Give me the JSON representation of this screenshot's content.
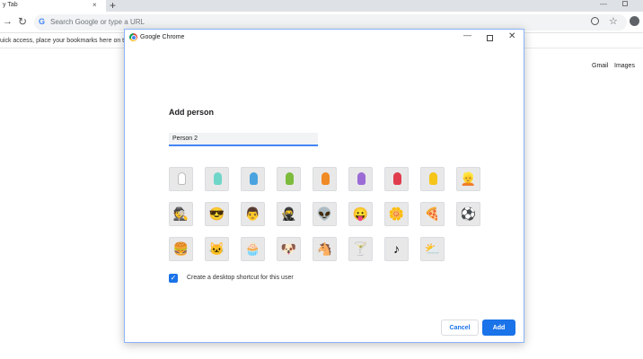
{
  "browser": {
    "tab_title": "y Tab",
    "tab_close": "×",
    "new_tab": "+",
    "window_min": "—",
    "omnibox_placeholder": "Search Google or type a URL",
    "omnibox_logo": "G",
    "bookmarks_hint": "uick access, place your bookmarks here on the",
    "gmail": "Gmail",
    "images": "Images"
  },
  "dialog": {
    "window_title": "Google Chrome",
    "heading": "Add person",
    "name_value": "Person 2",
    "checkbox_label": "Create a desktop shortcut for this user",
    "checkbox_checked": true,
    "cancel_label": "Cancel",
    "add_label": "Add",
    "accent_color": "#1a73e8",
    "avatars": [
      {
        "name": "white-person-avatar",
        "kind": "head",
        "color": "#ffffff"
      },
      {
        "name": "teal-person-avatar",
        "kind": "head",
        "color": "#6fd6c8"
      },
      {
        "name": "blue-person-avatar",
        "kind": "head",
        "color": "#4aa3df"
      },
      {
        "name": "green-person-avatar",
        "kind": "head",
        "color": "#7cbb3c"
      },
      {
        "name": "orange-person-avatar",
        "kind": "head",
        "color": "#f08a24"
      },
      {
        "name": "purple-person-avatar",
        "kind": "head",
        "color": "#9b6bd6"
      },
      {
        "name": "red-person-avatar",
        "kind": "head",
        "color": "#e03c4b"
      },
      {
        "name": "yellow-person-avatar",
        "kind": "head",
        "color": "#f5c518"
      },
      {
        "name": "ninja-blonde-avatar",
        "kind": "glyph",
        "glyph": "👱"
      },
      {
        "name": "businessman-avatar",
        "kind": "glyph",
        "glyph": "🕵"
      },
      {
        "name": "sunglasses-woman-avatar",
        "kind": "glyph",
        "glyph": "😎"
      },
      {
        "name": "man-avatar",
        "kind": "glyph",
        "glyph": "👨"
      },
      {
        "name": "ninja-avatar",
        "kind": "glyph",
        "glyph": "🥷"
      },
      {
        "name": "alien-avatar",
        "kind": "glyph",
        "glyph": "👽"
      },
      {
        "name": "smiley-avatar",
        "kind": "glyph",
        "glyph": "😛"
      },
      {
        "name": "flower-avatar",
        "kind": "glyph",
        "glyph": "🌼"
      },
      {
        "name": "pizza-avatar",
        "kind": "glyph",
        "glyph": "🍕"
      },
      {
        "name": "soccer-ball-avatar",
        "kind": "glyph",
        "glyph": "⚽"
      },
      {
        "name": "burger-avatar",
        "kind": "glyph",
        "glyph": "🍔"
      },
      {
        "name": "cat-avatar",
        "kind": "glyph",
        "glyph": "🐱"
      },
      {
        "name": "cupcake-avatar",
        "kind": "glyph",
        "glyph": "🧁"
      },
      {
        "name": "dog-avatar",
        "kind": "glyph",
        "glyph": "🐶"
      },
      {
        "name": "horse-avatar",
        "kind": "glyph",
        "glyph": "🐴"
      },
      {
        "name": "cocktail-avatar",
        "kind": "glyph",
        "glyph": "🍸"
      },
      {
        "name": "music-note-avatar",
        "kind": "glyph",
        "glyph": "♪"
      },
      {
        "name": "sun-cloud-avatar",
        "kind": "glyph",
        "glyph": "⛅"
      }
    ]
  }
}
